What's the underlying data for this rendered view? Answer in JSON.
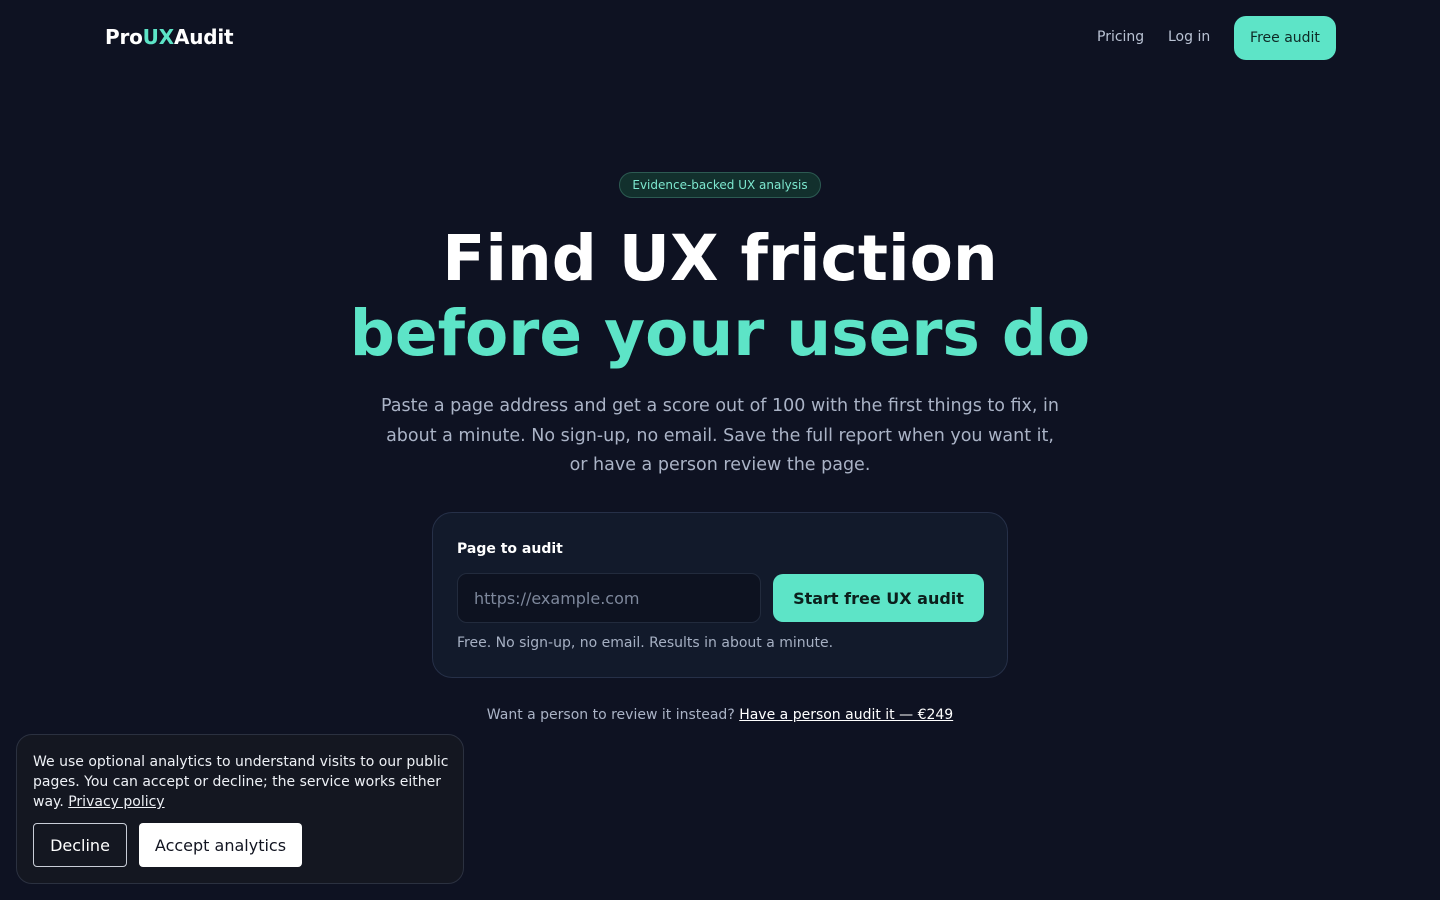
{
  "header": {
    "logo": {
      "part1": "Pro",
      "accent": "UX",
      "part2": "Audit"
    },
    "nav": {
      "pricing": "Pricing",
      "login": "Log in",
      "cta": "Free audit"
    }
  },
  "hero": {
    "badge": "Evidence-backed UX analysis",
    "title_line1": "Find UX friction",
    "title_line2": "before your users do",
    "subtitle": "Paste a page address and get a score out of 100 with the first things to fix, in about a minute. No sign-up, no email. Save the full report when you want it, or have a person review the page."
  },
  "audit_form": {
    "label": "Page to audit",
    "url_placeholder": "https://example.com",
    "url_value": "",
    "submit_label": "Start free UX audit",
    "note": "Free. No sign-up, no email. Results in about a minute."
  },
  "person_review": {
    "prompt": "Want a person to review it instead?",
    "link": "Have a person audit it — €249"
  },
  "cookie_banner": {
    "text": "We use optional analytics to understand visits to our public pages. You can accept or decline; the service works either way.",
    "privacy_link": "Privacy policy",
    "decline_label": "Decline",
    "accept_label": "Accept analytics"
  },
  "colors": {
    "background": "#0e1222",
    "accent": "#5de4c7",
    "card": "#121a2b"
  }
}
